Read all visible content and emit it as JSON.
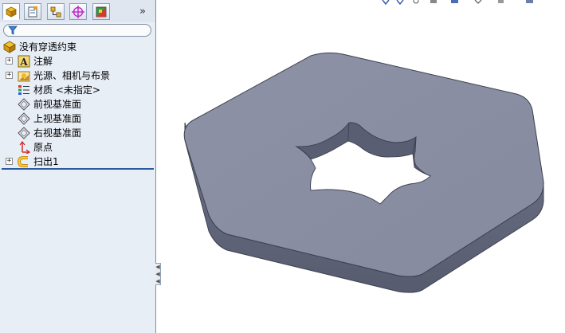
{
  "feature_manager": {
    "tabs": [
      {
        "name": "featuremanager-tab",
        "icon": "part-tree-icon",
        "active": true
      },
      {
        "name": "propertymanager-tab",
        "icon": "property-icon",
        "active": false
      },
      {
        "name": "configurationmanager-tab",
        "icon": "configuration-icon",
        "active": false
      },
      {
        "name": "dimxpert-tab",
        "icon": "target-icon",
        "active": false
      },
      {
        "name": "display-manager-tab",
        "icon": "display-icon",
        "active": false
      }
    ],
    "more_tabs_label": "»",
    "filter_icon": "funnel-icon",
    "tree": [
      {
        "label": "没有穿透约束",
        "icon": "part-icon",
        "expandable": false,
        "level": 0
      },
      {
        "label": "注解",
        "icon": "annotation-icon",
        "expandable": true,
        "level": 1
      },
      {
        "label": "光源、相机与布景",
        "icon": "lights-icon",
        "expandable": true,
        "level": 1
      },
      {
        "label": "材质 <未指定>",
        "icon": "material-icon",
        "expandable": false,
        "level": 1
      },
      {
        "label": "前视基准面",
        "icon": "plane-icon",
        "expandable": false,
        "level": 1
      },
      {
        "label": "上视基准面",
        "icon": "plane-icon",
        "expandable": false,
        "level": 1
      },
      {
        "label": "右视基准面",
        "icon": "plane-icon",
        "expandable": false,
        "level": 1
      },
      {
        "label": "原点",
        "icon": "origin-icon",
        "expandable": false,
        "level": 1
      },
      {
        "label": "扫出1",
        "icon": "sweep-icon",
        "expandable": true,
        "level": 1
      }
    ]
  },
  "graphics_area": {
    "model": "hex-plate-with-star-hole",
    "top_face_color": "#8b8fa3",
    "side_face_color": "#64687c",
    "edge_color": "#3d4050"
  },
  "colors": {
    "panel_bg": "#e8eef6",
    "panel_border": "#7d8ea6",
    "accent": "#2c5aa0"
  }
}
